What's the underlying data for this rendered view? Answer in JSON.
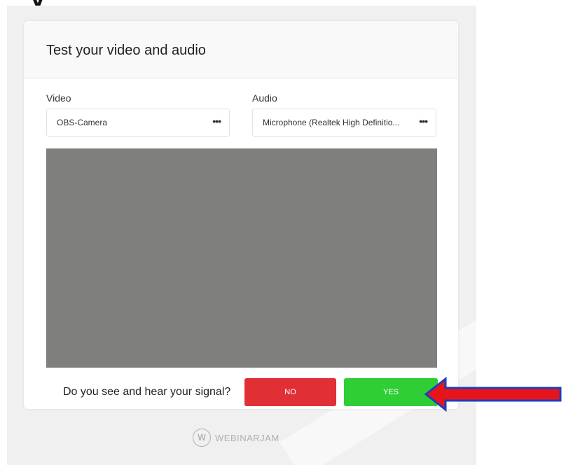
{
  "top_fragment": "y",
  "dialog": {
    "title": "Test your video and audio",
    "video_label": "Video",
    "video_value": "OBS-Camera",
    "audio_label": "Audio",
    "audio_value": "Microphone (Realtek High Definitio...",
    "more_glyph": "•••",
    "question": "Do you see and hear your signal?",
    "no_label": "NO",
    "yes_label": "YES"
  },
  "footer": {
    "logo_glyph": "W",
    "brand": "WEBINARJAM"
  },
  "colors": {
    "no_button": "#e03036",
    "yes_button": "#2fce35",
    "arrow_fill": "#e8141b",
    "arrow_stroke": "#1c3fb8",
    "preview": "#7f7f7d"
  }
}
